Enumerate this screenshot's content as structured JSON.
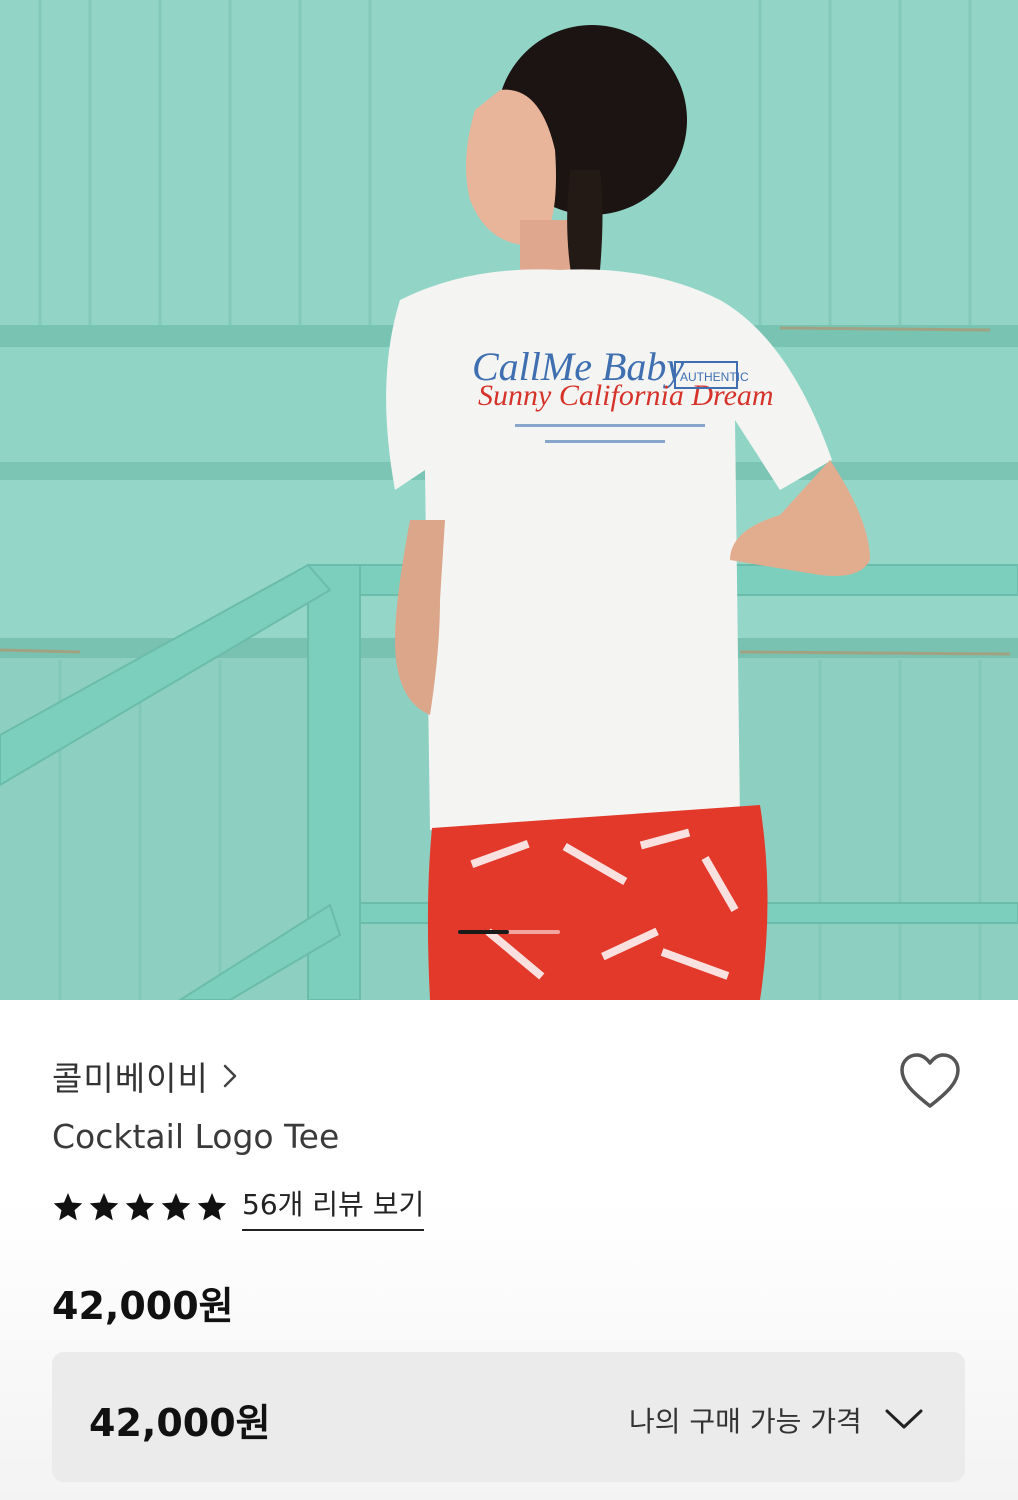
{
  "product": {
    "brand": "콜미베이비",
    "name": "Cocktail Logo Tee",
    "rating": 5,
    "rating_max": 5,
    "review_link": "56개 리뷰 보기",
    "price": "42,000원"
  },
  "my_price": {
    "value": "42,000원",
    "label": "나의 구매 가능 가격"
  },
  "hero": {
    "shirt_print_text": "CallMe Baby",
    "shirt_print_script": "Sunny California Dream",
    "shirt_print_tag": "AUTHENTIC",
    "carousel_position": 0.5
  },
  "icons": {
    "brand_chevron": "chevron-right-icon",
    "wish": "heart-outline-icon",
    "star": "star-filled-icon",
    "dropdown": "chevron-down-icon"
  },
  "colors": {
    "wall": "#8fd3c4",
    "shirt": "#f4f5f3",
    "skirt": "#e2392b",
    "price_box": "#ebebeb"
  }
}
